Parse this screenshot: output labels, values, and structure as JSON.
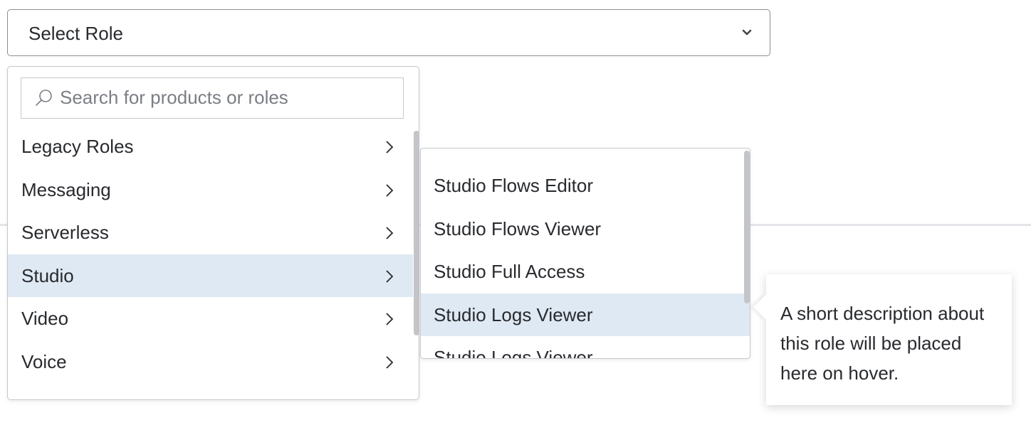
{
  "select": {
    "value": "Select Role",
    "chevron_icon": "chevron-down-icon"
  },
  "menu": {
    "search": {
      "placeholder": "Search for products or roles",
      "value": "",
      "icon": "search-icon"
    },
    "items": [
      {
        "label": "Legacy Roles",
        "active": false
      },
      {
        "label": "Messaging",
        "active": false
      },
      {
        "label": "Serverless",
        "active": false
      },
      {
        "label": "Studio",
        "active": true
      },
      {
        "label": "Video",
        "active": false
      },
      {
        "label": "Voice",
        "active": false
      }
    ],
    "item_chevron_icon": "chevron-right-icon"
  },
  "submenu": {
    "items": [
      {
        "label": "Studio Flows Editor",
        "active": false
      },
      {
        "label": "Studio Flows Viewer",
        "active": false
      },
      {
        "label": "Studio Full Access",
        "active": false
      },
      {
        "label": "Studio Logs Viewer",
        "active": true
      },
      {
        "label": "Studio Logs Viewer",
        "active": false
      }
    ]
  },
  "tooltip": {
    "text": "A short description about this role will be placed here on hover."
  },
  "colors": {
    "highlight": "#dfe9f3",
    "text": "#282a2e",
    "border": "#c6c8cc",
    "scrollbar": "#c3c5c9"
  }
}
